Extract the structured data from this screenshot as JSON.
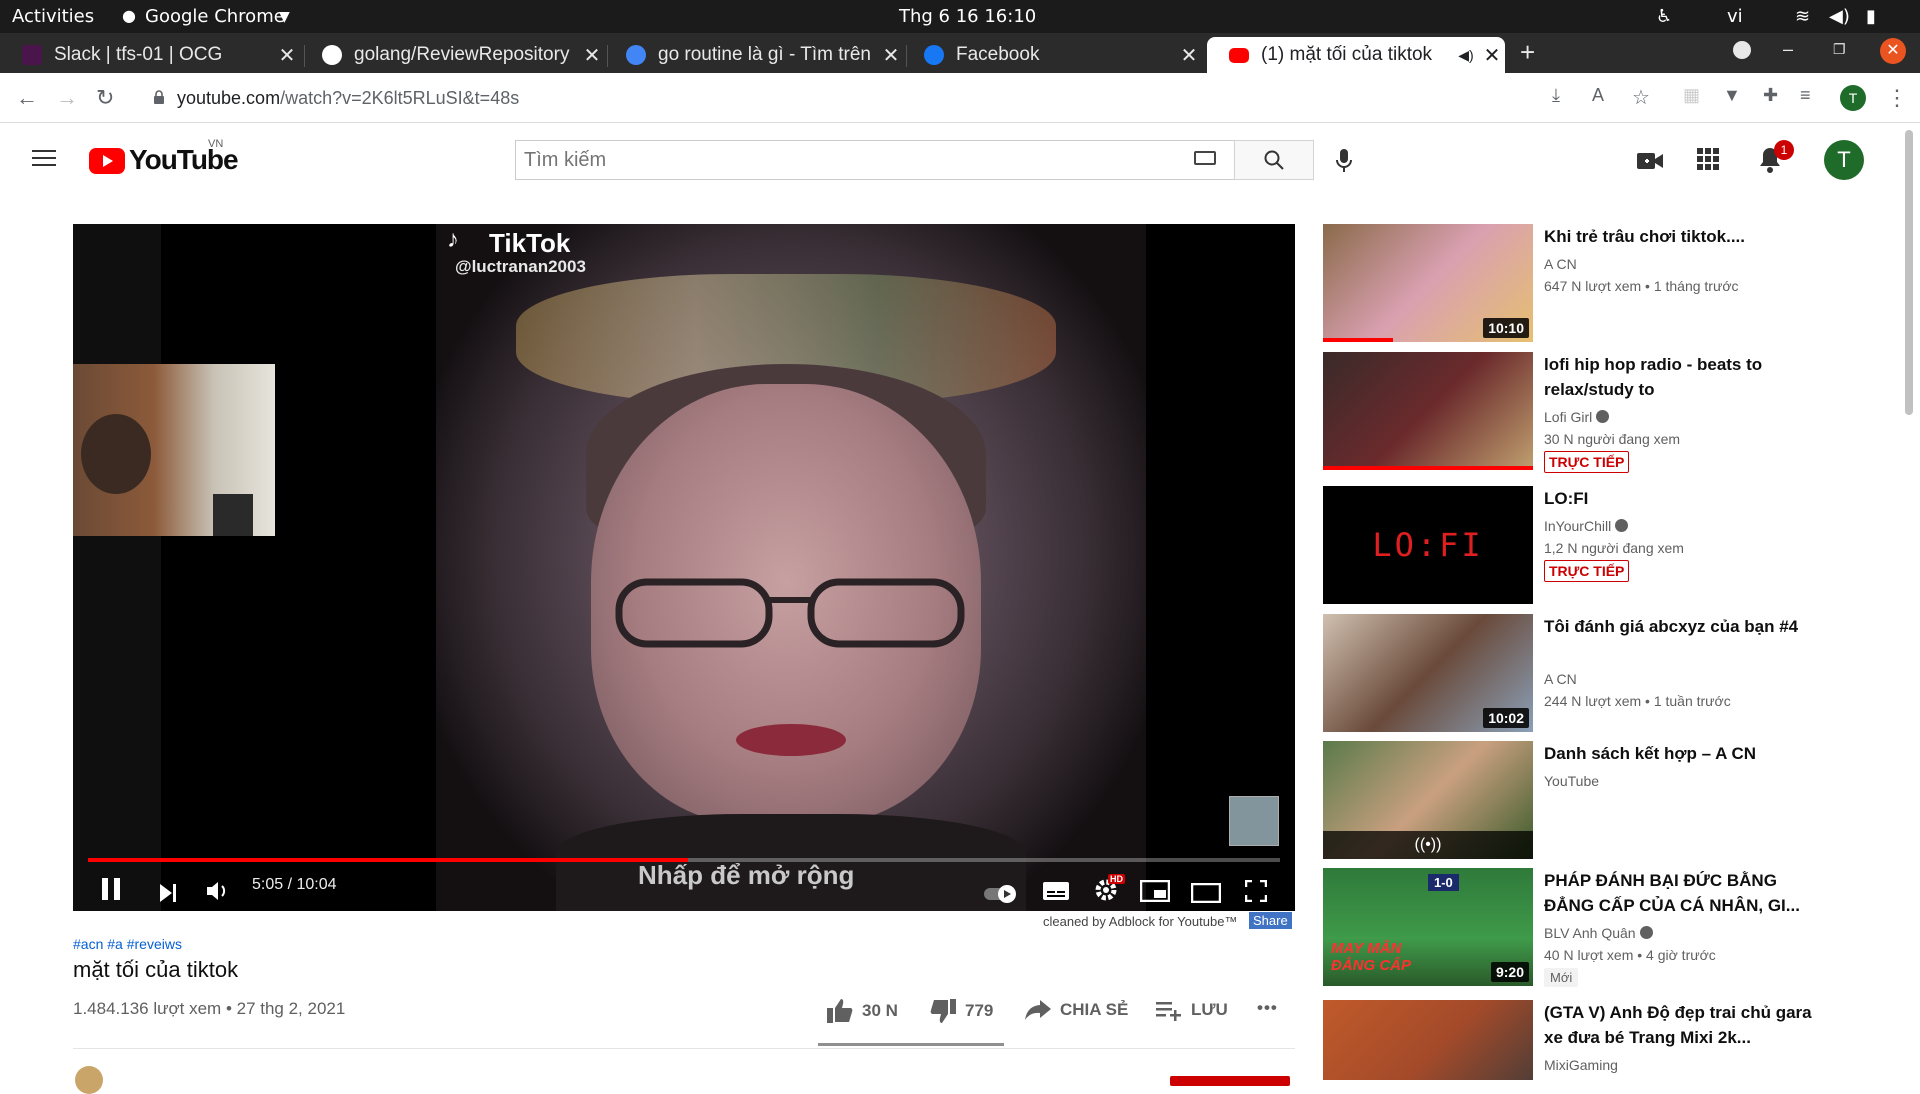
{
  "os_bar": {
    "activities": "Activities",
    "app": "Google Chrome",
    "datetime": "Thg 6 16  16:10",
    "lang": "vi"
  },
  "tabs": [
    {
      "title": "Slack | tfs-01 | OCG",
      "color": "#4a154b"
    },
    {
      "title": "golang/ReviewRepository",
      "color": "#ffffff"
    },
    {
      "title": "go routine là gì - Tìm trên",
      "color": "#4285f4"
    },
    {
      "title": "Facebook",
      "color": "#1877f2"
    },
    {
      "title": "(1) mặt tối của tiktok",
      "color": "#ff0000"
    }
  ],
  "address": {
    "host": "youtube.com",
    "path": "/watch?v=2K6lt5RLuSI&t=48s"
  },
  "yt": {
    "logo": "YouTube",
    "region": "VN",
    "search_placeholder": "Tìm kiếm",
    "notif_count": "1",
    "avatar_letter": "T"
  },
  "player": {
    "watermark": "TikTok",
    "handle": "@luctranan2003",
    "time": "5:05 / 10:04",
    "progress_fraction": 0.503,
    "expand_hint": "Nhấp để mở rộng",
    "hd_badge": "HD"
  },
  "below": {
    "adblock_note": "cleaned by Adblock for Youtube™",
    "share_mini": "Share",
    "hashtags": "#acn #a #reveiws",
    "title": "mặt tối của tiktok",
    "meta": "1.484.136 lượt xem • 27 thg 2, 2021",
    "likes": "30 N",
    "dislikes": "779",
    "share": "CHIA SẺ",
    "save": "LƯU",
    "more": "•••"
  },
  "recommendations": [
    {
      "title": "Khi trẻ trâu chơi tiktok....",
      "channel": "A CN",
      "meta": "647 N lượt xem • 1 tháng trước",
      "duration": "10:10",
      "thumb": "#c96a73"
    },
    {
      "title": "lofi hip hop radio - beats to relax/study to",
      "channel": "Lofi Girl",
      "meta": "30 N người đang xem",
      "live": "TRỰC TIẾP",
      "thumb": "#6b2a2c"
    },
    {
      "title": "LO:FI",
      "channel": "InYourChill",
      "meta": "1,2 N người đang xem",
      "live": "TRỰC TIẾP",
      "thumb": "#000000",
      "thumb_text": "LO:FI"
    },
    {
      "title": "Tôi đánh giá abcxyz của bạn #4",
      "channel": "A CN",
      "meta": "244 N lượt xem • 1 tuần trước",
      "duration": "10:02",
      "thumb": "#8a6a5a"
    },
    {
      "title": "Danh sách kết hợp – A CN",
      "channel": "YouTube",
      "thumb": "#6b8f5a"
    },
    {
      "title": "PHÁP ĐÁNH BẠI ĐỨC BẰNG ĐẲNG CẤP CỦA CÁ NHÂN, GI...",
      "channel": "BLV Anh Quân",
      "meta": "40 N lượt xem • 4 giờ trước",
      "duration": "9:20",
      "badge": "Mới",
      "thumb": "#2f7a3a",
      "thumb_score": "1-0",
      "thumb_caption": "MAY MẮN ĐẲNG CẤP"
    },
    {
      "title": "(GTA V) Anh Độ đẹp trai chủ gara xe đưa bé Trang Mixi 2k...",
      "channel": "MixiGaming",
      "thumb": "#a34a2a"
    }
  ]
}
